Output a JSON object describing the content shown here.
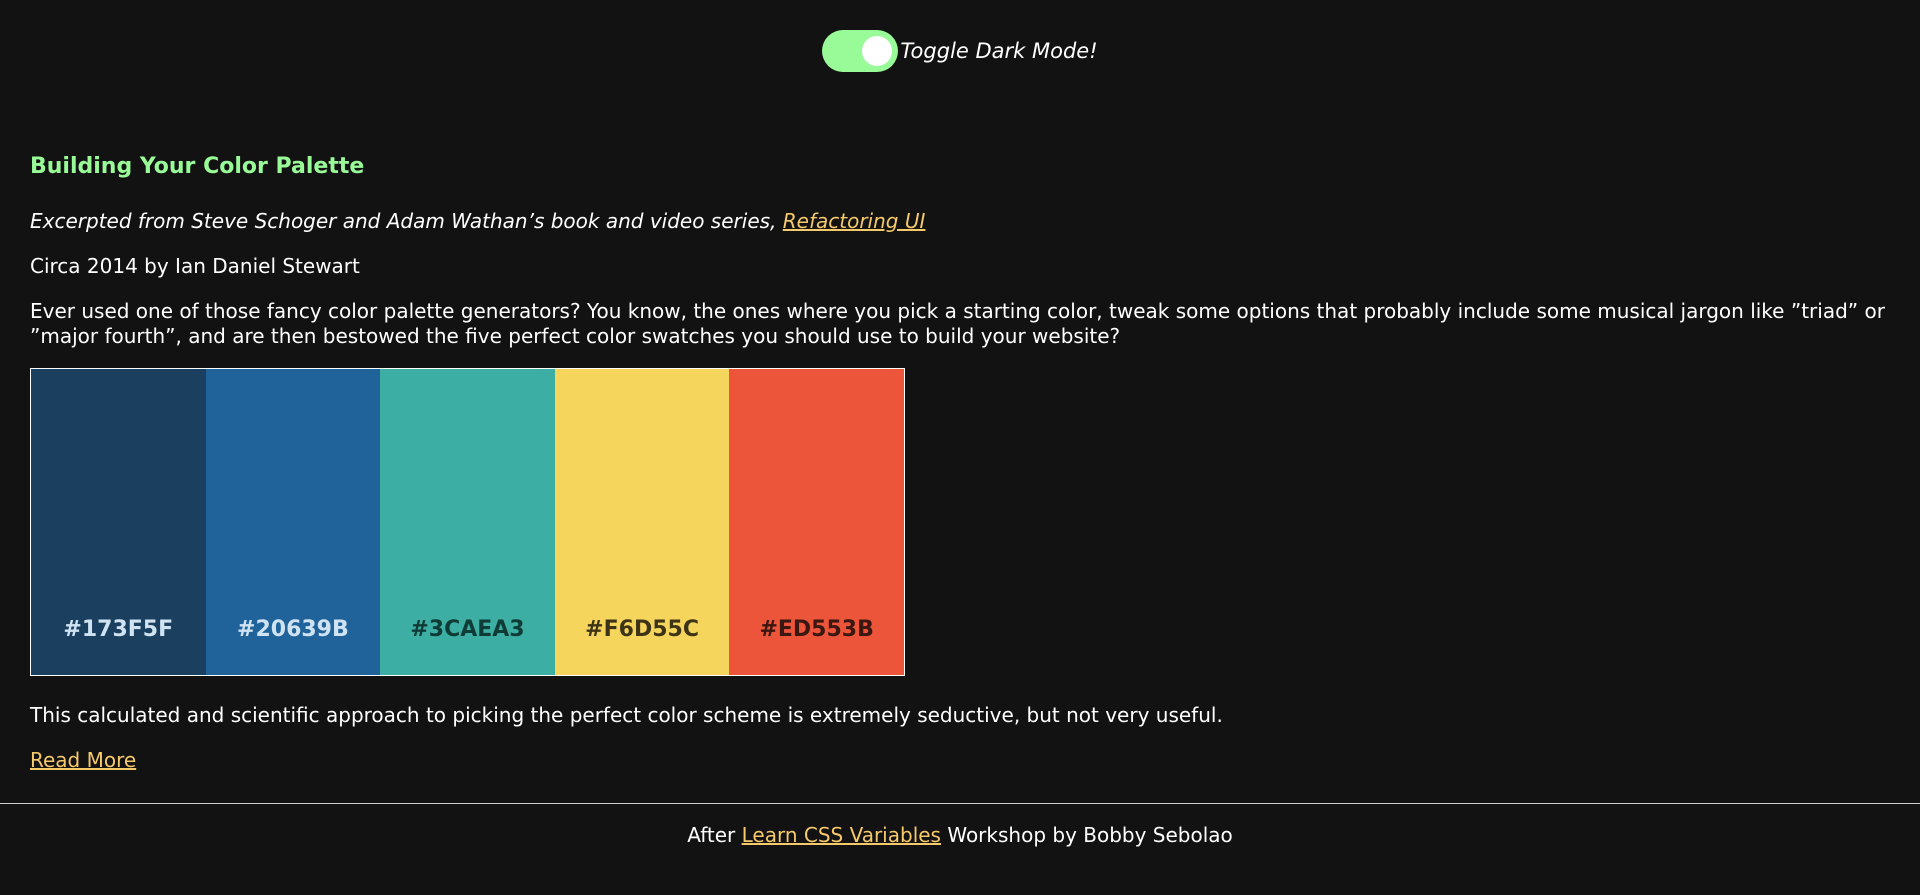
{
  "toggle": {
    "label": "Toggle Dark Mode!",
    "state": "on",
    "color": "#98fb98"
  },
  "article": {
    "heading": "Building Your Color Palette",
    "excerpt_prefix": "Excerpted from Steve Schoger and Adam Wathan’s book and video series, ",
    "excerpt_link": "Refactoring UI",
    "circa": "Circa 2014 by Ian Daniel Stewart",
    "intro": "Ever used one of those fancy color palette generators? You know, the ones where you pick a starting color, tweak some options that probably include some musical jargon like ”triad” or ”major fourth”, and are then bestowed the five perfect color swatches you should use to build your website?",
    "closing": "This calculated and scientific approach to picking the perfect color scheme is extremely seductive, but not very useful.",
    "read_more": "Read More"
  },
  "palette": [
    {
      "hex": "#173F5F",
      "bg": "#1a3f5f",
      "text_color": "#cfe3f2"
    },
    {
      "hex": "#20639B",
      "bg": "#20639b",
      "text_color": "#cfe3f2"
    },
    {
      "hex": "#3CAEA3",
      "bg": "#3caea3",
      "text_color": "#0f3b37"
    },
    {
      "hex": "#F6D55C",
      "bg": "#f6d55c",
      "text_color": "#3d3416"
    },
    {
      "hex": "#ED553B",
      "bg": "#ed553b",
      "text_color": "#3a1710"
    }
  ],
  "footer": {
    "prefix": "After ",
    "link": "Learn CSS Variables",
    "suffix": " Workshop by Bobby Sebolao"
  },
  "colors": {
    "background": "#121212",
    "accent_green": "#98fb98",
    "link": "#f6c96a",
    "text": "#ffffff"
  }
}
